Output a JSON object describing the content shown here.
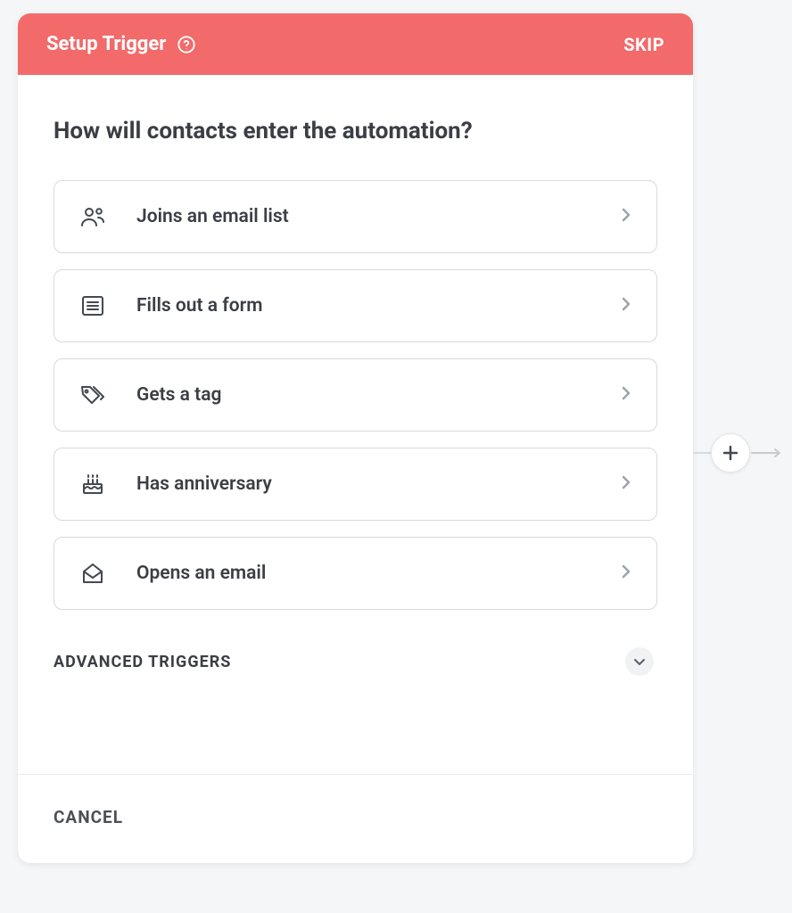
{
  "header": {
    "title": "Setup Trigger",
    "skip_label": "SKIP"
  },
  "question": "How will contacts enter the automation?",
  "triggers": [
    {
      "icon": "people-icon",
      "label": "Joins an email list"
    },
    {
      "icon": "form-icon",
      "label": "Fills out a form"
    },
    {
      "icon": "tag-icon",
      "label": "Gets a tag"
    },
    {
      "icon": "cake-icon",
      "label": "Has anniversary"
    },
    {
      "icon": "mail-open-icon",
      "label": "Opens an email"
    }
  ],
  "advanced_label": "ADVANCED TRIGGERS",
  "footer": {
    "cancel_label": "CANCEL"
  }
}
